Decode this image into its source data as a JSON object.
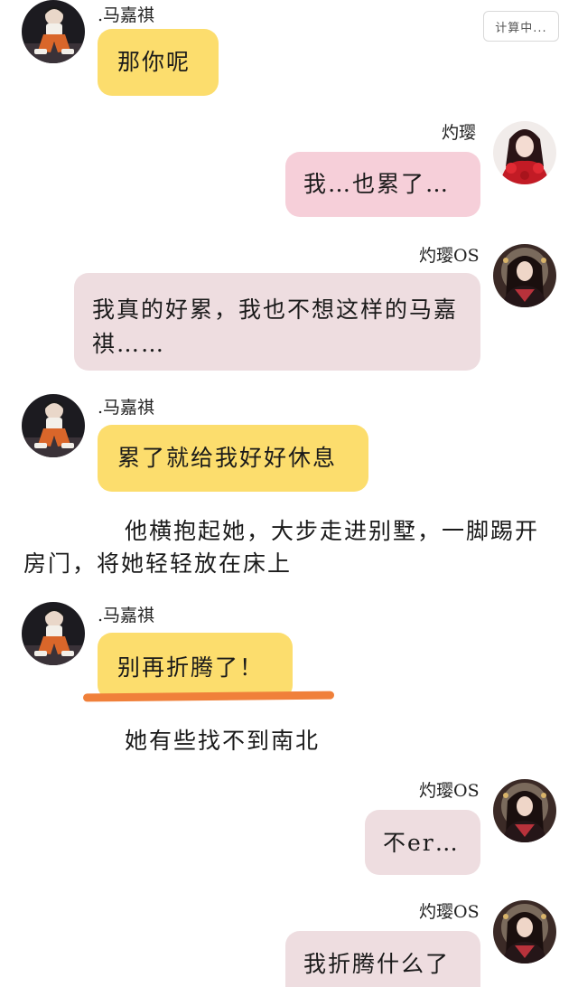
{
  "status": {
    "label": "计算中..."
  },
  "names": {
    "male": ".马嘉祺",
    "female": "灼璎",
    "female_os": "灼璎OS"
  },
  "messages": [
    {
      "speaker": "male",
      "text": "那你呢"
    },
    {
      "speaker": "female",
      "text": "我…也累了…"
    },
    {
      "speaker": "female_os",
      "text": "我真的好累，我也不想这样的马嘉祺……"
    },
    {
      "speaker": "male",
      "text": "累了就给我好好休息"
    },
    {
      "speaker": "narration",
      "text": "他横抱起她，大步走进别墅，一脚踢开房门，将她轻轻放在床上"
    },
    {
      "speaker": "male",
      "text": "别再折腾了！"
    },
    {
      "speaker": "narration",
      "text": "她有些找不到南北"
    },
    {
      "speaker": "female_os",
      "text": "不er…"
    },
    {
      "speaker": "female_os",
      "text": "我折腾什么了"
    }
  ],
  "colors": {
    "male_bubble": "#fcdd6d",
    "female_bubble": "#f6cfd9",
    "os_bubble": "#eedde0",
    "underline": "#f0803a"
  }
}
